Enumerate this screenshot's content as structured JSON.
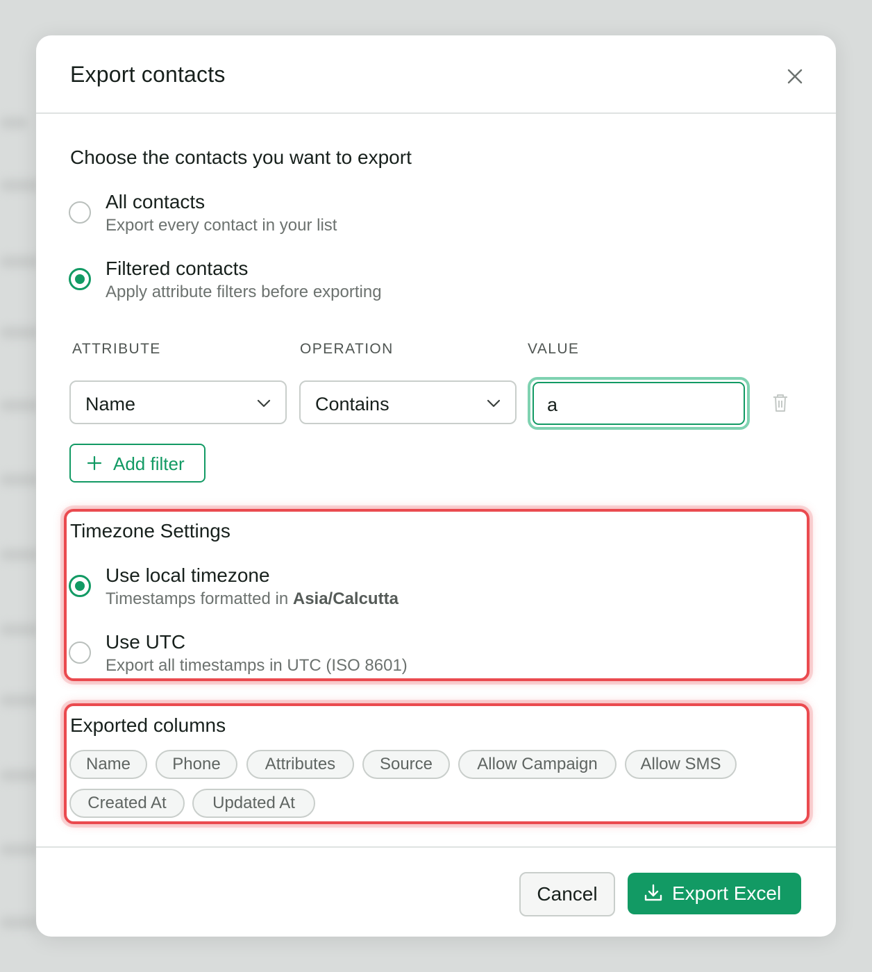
{
  "dialog": {
    "title": "Export contacts",
    "close_icon": "close-icon"
  },
  "scope": {
    "heading": "Choose the contacts you want to export",
    "options": [
      {
        "label": "All contacts",
        "description": "Export every contact in your list",
        "checked": false
      },
      {
        "label": "Filtered contacts",
        "description": "Apply attribute filters before exporting",
        "checked": true
      }
    ]
  },
  "filters": {
    "headers": {
      "attribute": "ATTRIBUTE",
      "operation": "OPERATION",
      "value": "VALUE"
    },
    "row": {
      "attribute": "Name",
      "operation": "Contains",
      "value": "a"
    },
    "add_label": "Add filter",
    "delete_icon": "trash-icon"
  },
  "timezone": {
    "heading": "Timezone Settings",
    "local": {
      "label": "Use local timezone",
      "description_prefix": "Timestamps formatted in ",
      "zone": "Asia/Calcutta",
      "checked": true
    },
    "utc": {
      "label": "Use UTC",
      "description": "Export all timestamps in UTC (ISO 8601)",
      "checked": false
    }
  },
  "columns": {
    "heading": "Exported columns",
    "items": [
      "Name",
      "Phone",
      "Attributes",
      "Source",
      "Allow Campaign",
      "Allow SMS",
      "Created At",
      "Updated At"
    ]
  },
  "footer": {
    "cancel_label": "Cancel",
    "export_label": "Export Excel",
    "export_icon": "download-icon"
  },
  "colors": {
    "accent": "#129a64",
    "highlight": "#ea4a4f"
  }
}
